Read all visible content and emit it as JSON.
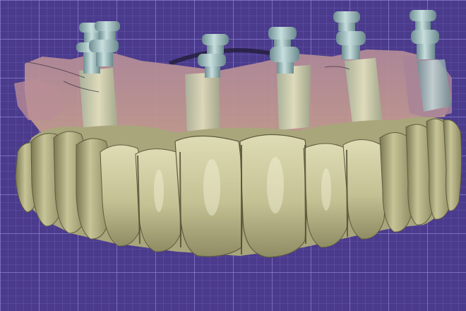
{
  "viewport": {
    "background_color": "#4b3b8c",
    "grid_color": "#9a8fd8"
  },
  "model": {
    "tooth_color": "#c9c69a",
    "gingiva_color": "#c9a08c",
    "scanbody_color": "#8fb0b2",
    "implant_count": 6,
    "upper_tooth_count": 14
  }
}
